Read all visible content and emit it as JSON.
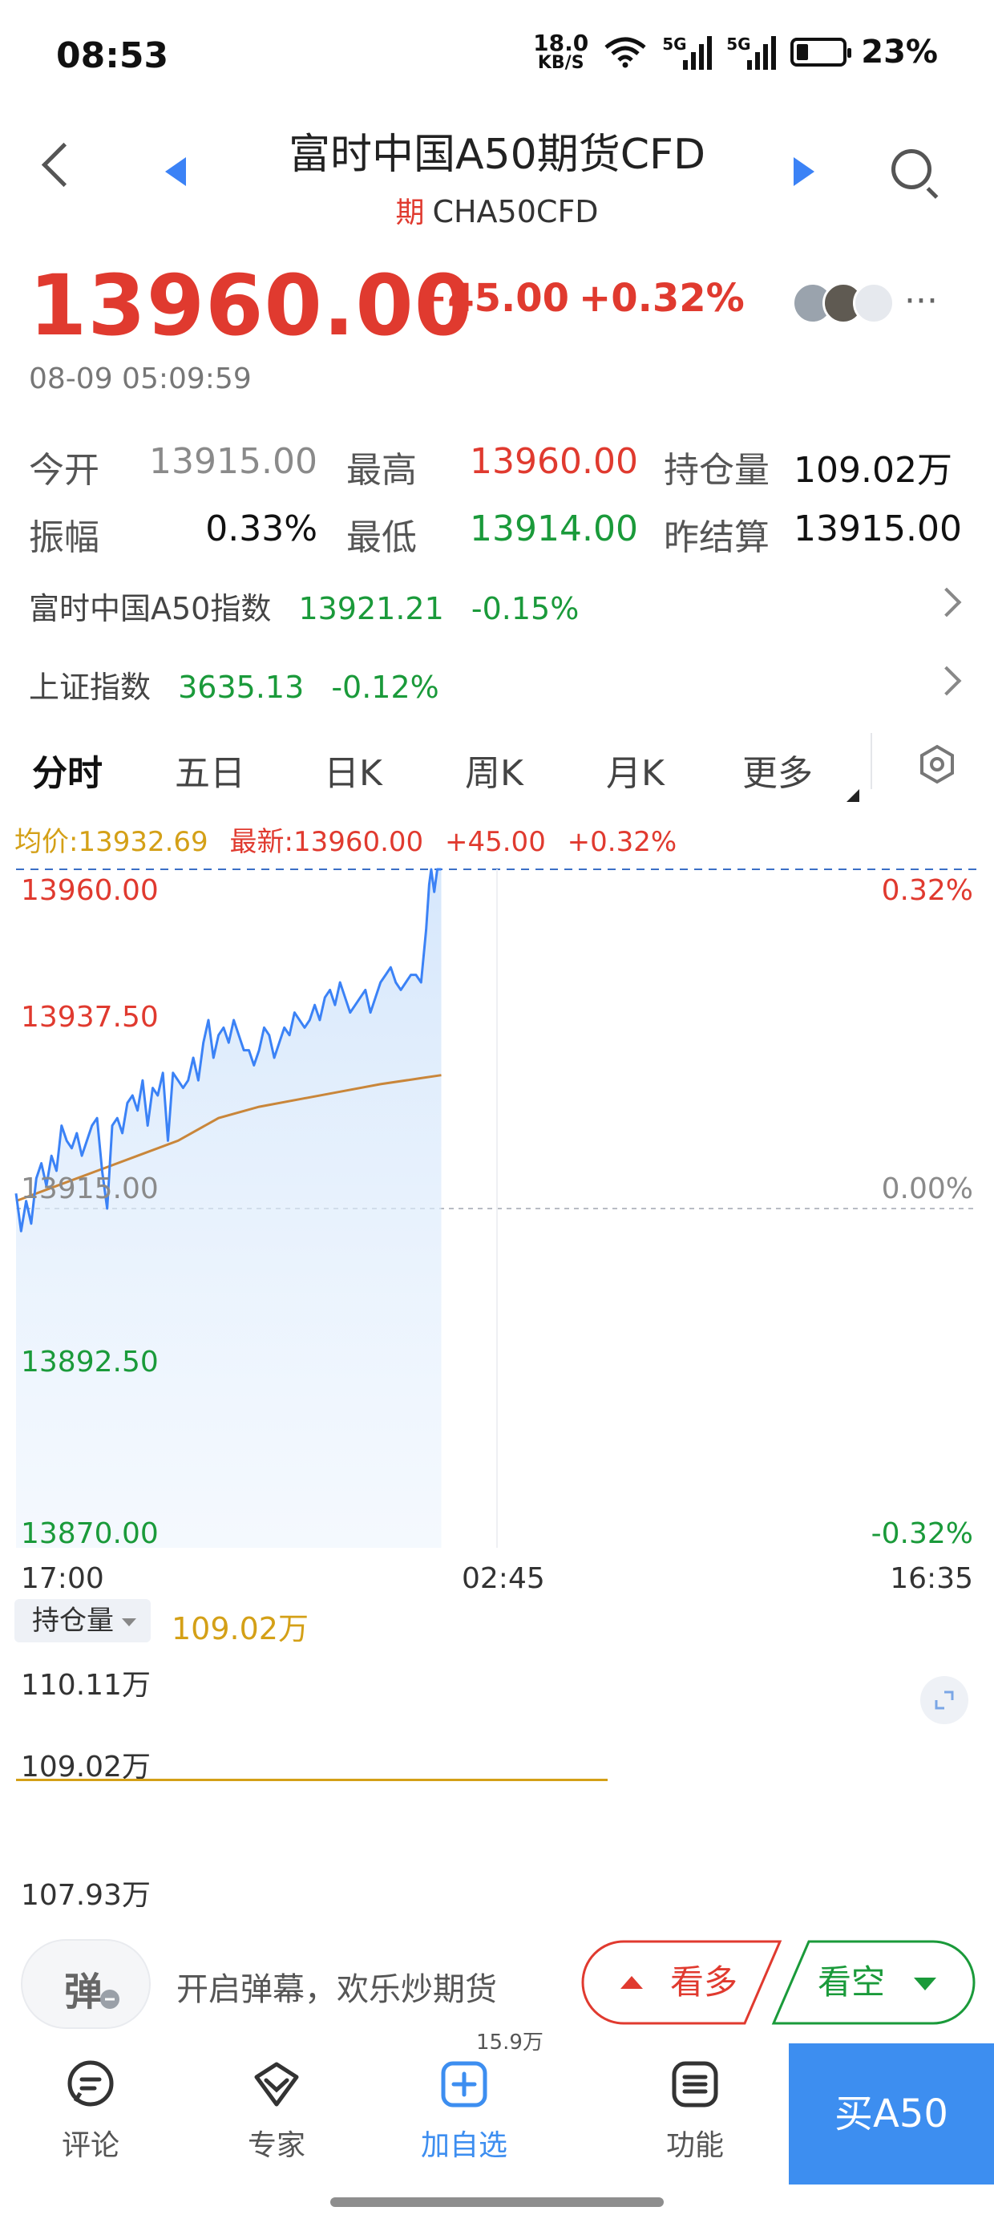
{
  "status": {
    "time": "08:53",
    "netspeed_value": "18.0",
    "netspeed_unit": "KB/S",
    "signal1_tag": "5G",
    "signal2_tag": "5G",
    "battery": "23%"
  },
  "header": {
    "title": "富时中国A50期货CFD",
    "badge": "期",
    "code": "CHA50CFD"
  },
  "quote": {
    "price": "13960.00",
    "change": "+45.00",
    "change_pct": "+0.32%",
    "more": "···",
    "timestamp": "08-09 05:09:59"
  },
  "stats": {
    "open_label": "今开",
    "open_value": "13915.00",
    "high_label": "最高",
    "high_value": "13960.00",
    "oi_label": "持仓量",
    "oi_value": "109.02万",
    "amp_label": "振幅",
    "amp_value": "0.33%",
    "low_label": "最低",
    "low_value": "13914.00",
    "settle_label": "昨结算",
    "settle_value": "13915.00"
  },
  "indices": [
    {
      "name": "富时中国A50指数",
      "value": "13921.21",
      "pct": "-0.15%"
    },
    {
      "name": "上证指数",
      "value": "3635.13",
      "pct": "-0.12%"
    }
  ],
  "tabs": [
    "分时",
    "五日",
    "日K",
    "周K",
    "月K",
    "更多"
  ],
  "chart_info": {
    "avg": "均价:13932.69",
    "latest": "最新:13960.00",
    "change": "+45.00",
    "pct": "+0.32%"
  },
  "chart_data": {
    "type": "line",
    "y_ticks_left": [
      "13960.00",
      "13937.50",
      "13915.00",
      "13892.50",
      "13870.00"
    ],
    "y_ticks_right": [
      "0.32%",
      "0.00%",
      "-0.32%"
    ],
    "x_ticks": [
      "17:00",
      "02:45",
      "16:35"
    ],
    "ylim": [
      13870,
      13960
    ],
    "reference_price": 13915,
    "series": [
      {
        "name": "price",
        "color": "#3b82f6",
        "t": [
          0,
          0.5,
          1,
          1.5,
          2,
          2.5,
          3,
          3.5,
          4,
          4.5,
          5,
          5.5,
          6,
          6.5,
          7,
          7.5,
          8,
          8.5,
          9,
          9.5,
          10,
          10.5,
          11,
          11.5,
          12,
          12.5,
          13,
          13.5,
          14,
          14.5,
          15,
          15.5,
          16,
          16.5,
          17,
          17.5,
          18,
          18.5,
          19,
          19.5,
          20,
          20.5,
          21,
          21.5,
          22,
          22.5,
          23,
          23.5,
          24,
          24.5,
          25,
          25.5,
          26,
          26.5,
          27,
          27.5,
          28,
          28.5,
          29,
          29.5,
          30,
          30.5,
          31,
          31.5,
          32,
          32.5,
          33,
          33.5,
          34,
          34.5,
          35,
          35.5,
          36,
          36.5,
          37,
          37.5,
          38,
          38.5,
          39,
          39.5,
          40,
          40.5,
          40.8,
          41,
          41.3,
          41.6,
          42
        ],
        "values": [
          13917,
          13912,
          13916,
          13913,
          13919,
          13921,
          13918,
          13922,
          13920,
          13926,
          13924,
          13923,
          13925,
          13922,
          13924,
          13926,
          13927,
          13920,
          13915,
          13926,
          13927,
          13925,
          13929,
          13930,
          13928,
          13932,
          13926,
          13931,
          13930,
          13933,
          13924,
          13933,
          13932,
          13931,
          13932,
          13935,
          13932,
          13937,
          13940,
          13935,
          13938,
          13939,
          13937,
          13940,
          13938,
          13936,
          13936,
          13934,
          13936,
          13939,
          13938,
          13935,
          13937,
          13939,
          13938,
          13941,
          13940,
          13939,
          13940,
          13942,
          13940,
          13943,
          13944,
          13942,
          13945,
          13943,
          13941,
          13942,
          13943,
          13944,
          13941,
          13943,
          13945,
          13946,
          13947,
          13945,
          13944,
          13945,
          13946,
          13946,
          13945,
          13952,
          13958,
          13960,
          13957,
          13960,
          13960
        ]
      },
      {
        "name": "avg",
        "color": "#c9863a",
        "t": [
          0,
          4,
          8,
          12,
          16,
          20,
          24,
          28,
          32,
          36,
          40,
          42
        ],
        "values": [
          13916,
          13918,
          13920,
          13922,
          13924,
          13927,
          13928.5,
          13929.5,
          13930.5,
          13931.5,
          13932.3,
          13932.69
        ]
      }
    ],
    "grid": true
  },
  "open_interest": {
    "select_label": "持仓量",
    "value": "109.02万",
    "y_ticks": [
      "110.11万",
      "109.02万",
      "107.93万"
    ]
  },
  "danmu": {
    "button_label": "弹",
    "prompt": "开启弹幕，欢乐炒期货"
  },
  "trade": {
    "long_label": "看多",
    "short_label": "看空"
  },
  "nav": {
    "comment": "评论",
    "expert": "专家",
    "add_watch": "加自选",
    "add_watch_count": "15.9万",
    "function": "功能",
    "buy": "买A50"
  },
  "colors": {
    "up": "#e03a2f",
    "down": "#1a9a3a",
    "accent": "#3d8ef0",
    "avg_line": "#c9863a"
  }
}
